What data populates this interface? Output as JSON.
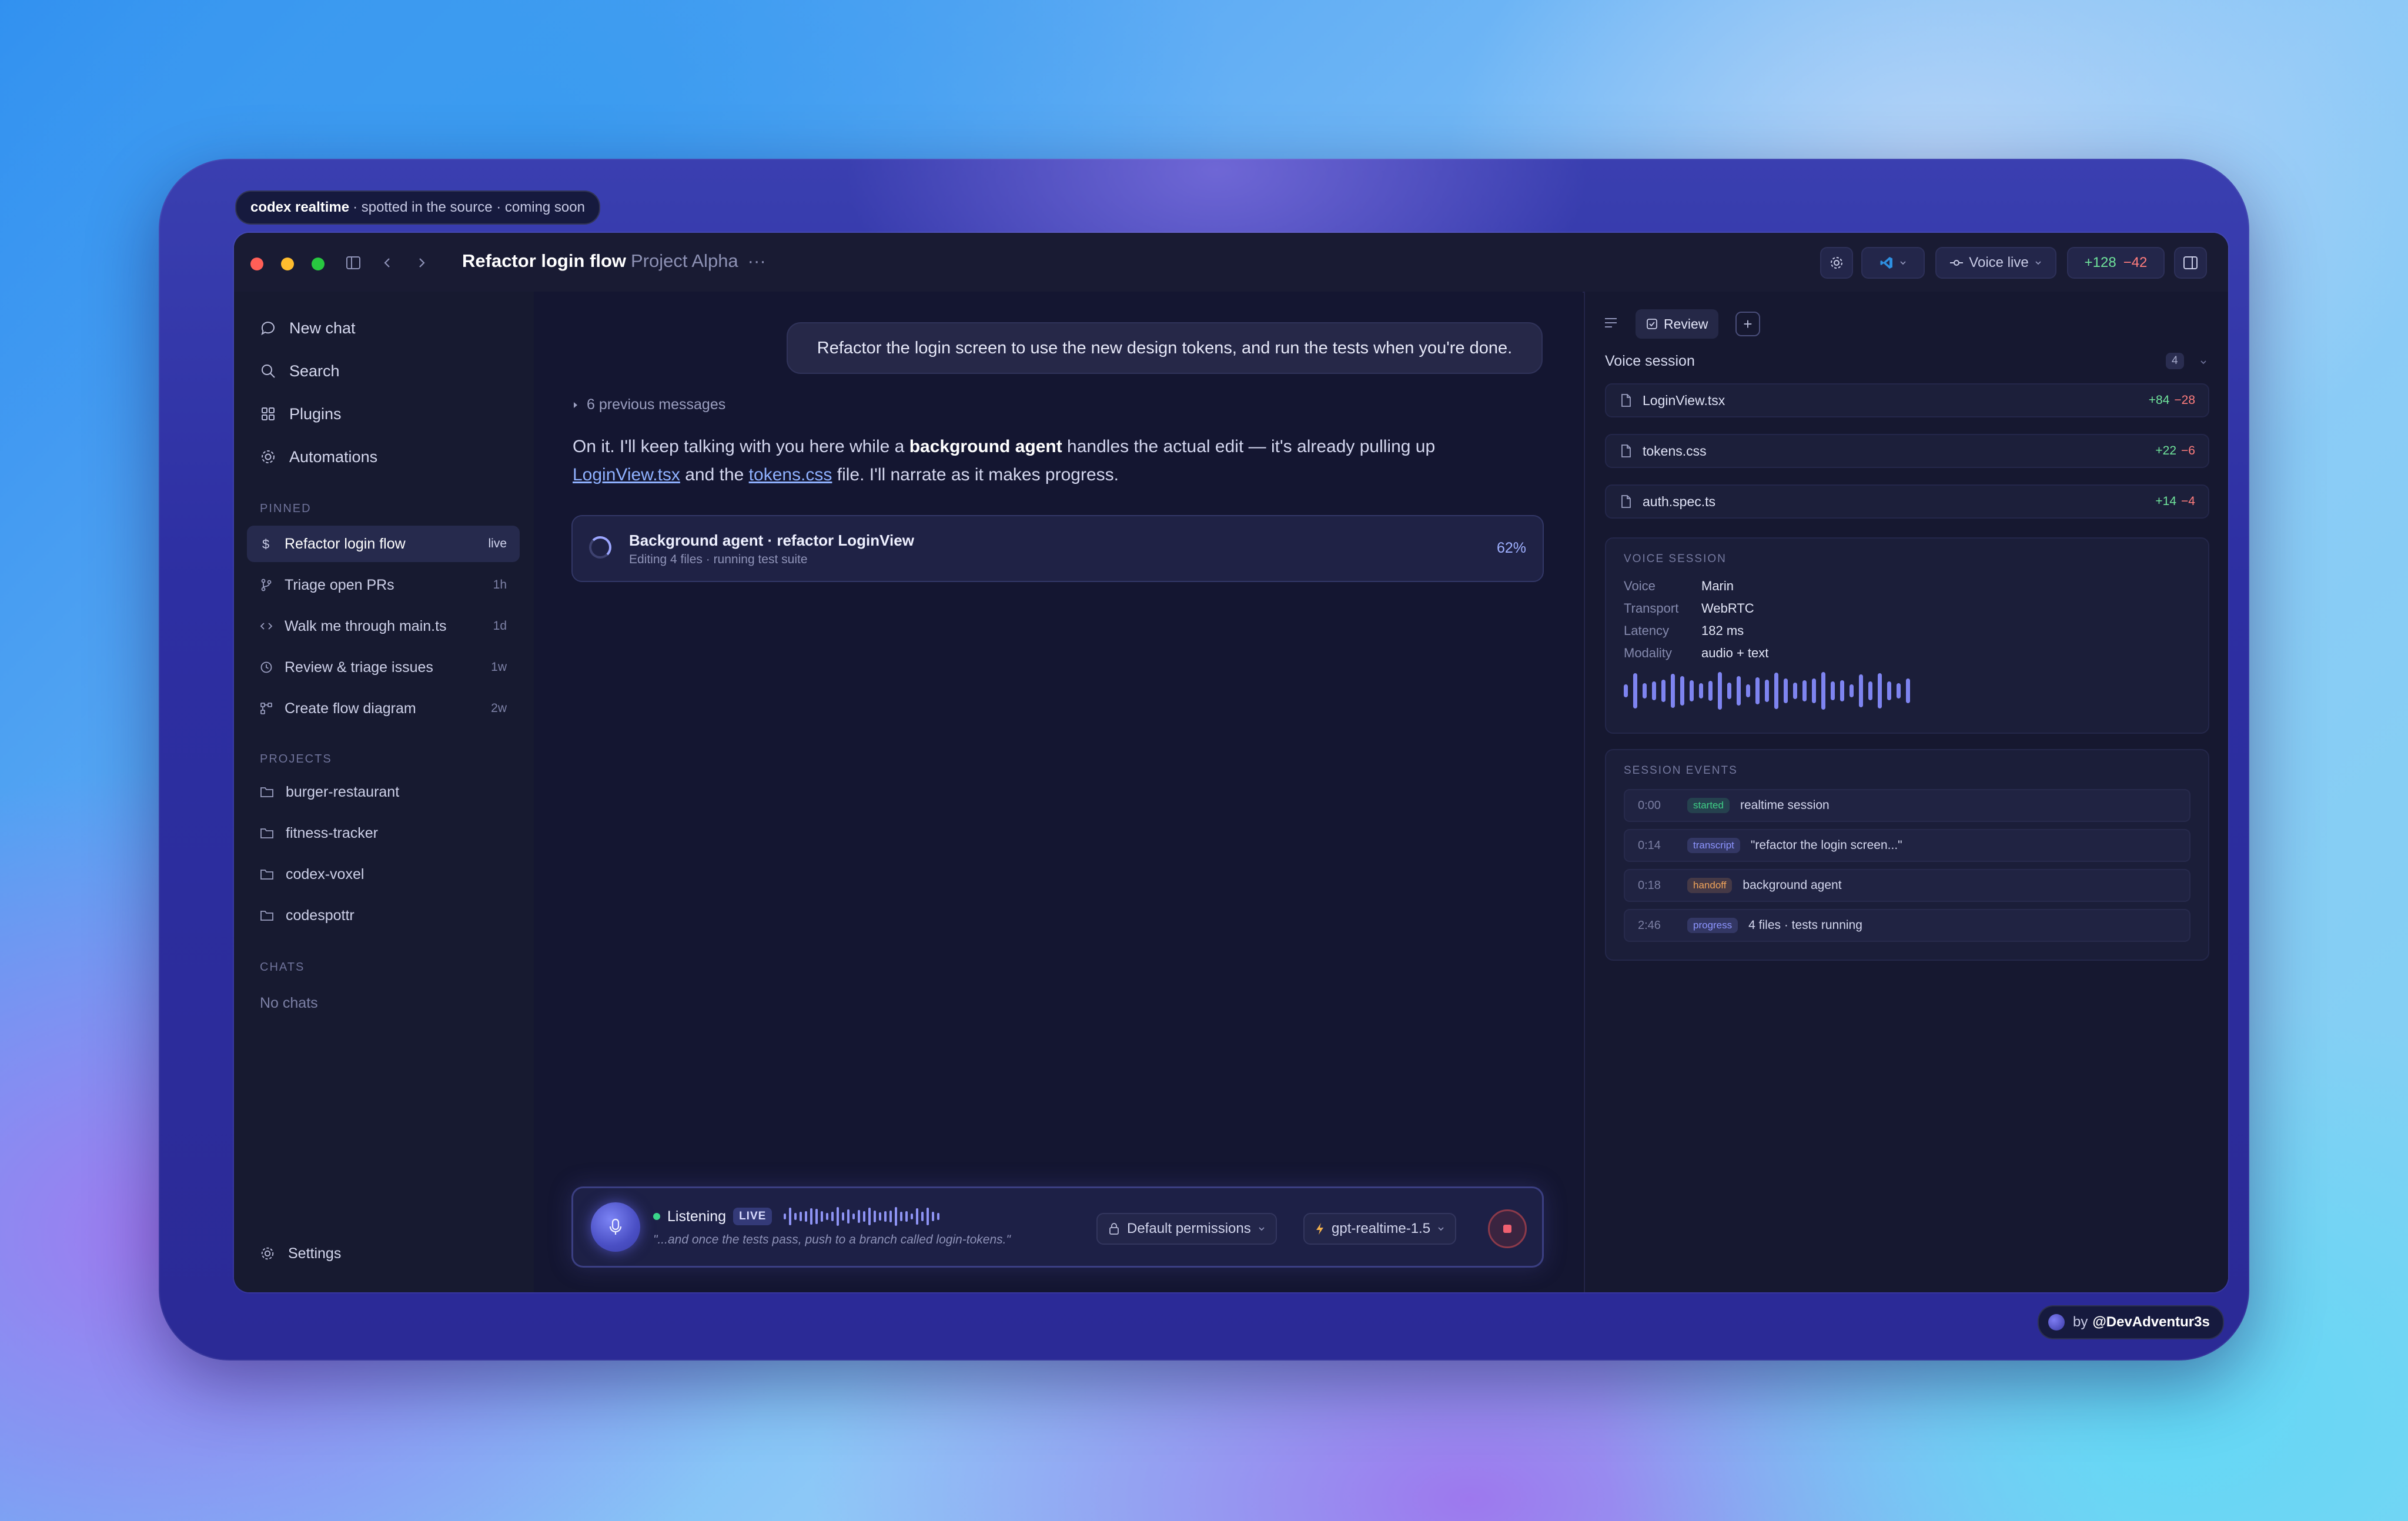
{
  "banner": {
    "brand": "codex realtime",
    "text": "· spotted in the source · coming soon"
  },
  "credit": {
    "prefix": "by",
    "handle": "@DevAdventur3s"
  },
  "titlebar": {
    "title": "Refactor login flow",
    "project": "Project Alpha",
    "more": "···",
    "voice_label": "Voice live",
    "diff_add": "+128",
    "diff_del": "−42"
  },
  "sidebar": {
    "nav": [
      {
        "label": "New chat",
        "icon": "chat-bubble-icon"
      },
      {
        "label": "Search",
        "icon": "search-icon"
      },
      {
        "label": "Plugins",
        "icon": "grid-icon"
      },
      {
        "label": "Automations",
        "icon": "gear-icon"
      }
    ],
    "pinned_label": "PINNED",
    "pinned": [
      {
        "label": "Refactor login flow",
        "age": "live",
        "icon": "dollar-icon"
      },
      {
        "label": "Triage open PRs",
        "age": "1h",
        "icon": "branch-icon"
      },
      {
        "label": "Walk me through main.ts",
        "age": "1d",
        "icon": "code-icon"
      },
      {
        "label": "Review & triage issues",
        "age": "1w",
        "icon": "clock-icon"
      },
      {
        "label": "Create flow diagram",
        "age": "2w",
        "icon": "flow-icon"
      }
    ],
    "projects_label": "PROJECTS",
    "projects": [
      "burger-restaurant",
      "fitness-tracker",
      "codex-voxel",
      "codespottr"
    ],
    "chats_label": "CHATS",
    "no_chats": "No chats",
    "settings": "Settings"
  },
  "chat": {
    "user_message": "Refactor the login screen to use the new design tokens, and run the tests when you're done.",
    "previous": "6 previous messages",
    "reply_1": "On it. I'll keep talking with you here while a ",
    "reply_bold": "background agent",
    "reply_2": " handles the actual edit — it's already pulling up ",
    "link_1": "LoginView.tsx",
    "reply_3": " and the ",
    "link_2": "tokens.css",
    "reply_4": " file. I'll narrate as it makes progress.",
    "agent_title": "Background agent · refactor LoginView",
    "agent_sub": "Editing 4 files · running test suite",
    "agent_progress": "62%"
  },
  "voicebar": {
    "status": "Listening",
    "live": "LIVE",
    "transcript": "\"...and once the tests pass, push to a branch called login-tokens.\"",
    "permissions": "Default permissions",
    "model": "gpt-realtime-1.5"
  },
  "review": {
    "tab": "Review",
    "session_title": "Voice session",
    "session_count": "4",
    "files": [
      {
        "name": "LoginView.tsx",
        "add": "+84",
        "del": "−28"
      },
      {
        "name": "tokens.css",
        "add": "+22",
        "del": "−6"
      },
      {
        "name": "auth.spec.ts",
        "add": "+14",
        "del": "−4"
      }
    ],
    "details_label": "VOICE SESSION",
    "details": [
      {
        "key": "Voice",
        "value": "Marin"
      },
      {
        "key": "Transport",
        "value": "WebRTC"
      },
      {
        "key": "Latency",
        "value": "182 ms"
      },
      {
        "key": "Modality",
        "value": "audio + text"
      }
    ],
    "events_label": "SESSION EVENTS",
    "events": [
      {
        "time": "0:00",
        "tag": "started",
        "text": "realtime session",
        "tag_color": "#3fcf86"
      },
      {
        "time": "0:14",
        "tag": "transcript",
        "text": "\"refactor the login screen...\"",
        "tag_color": "#8d95ff"
      },
      {
        "time": "0:18",
        "tag": "handoff",
        "text": "background agent",
        "tag_color": "#f0a35a"
      },
      {
        "time": "2:46",
        "tag": "progress",
        "text": "4 files · tests running",
        "tag_color": "#8d95ff"
      }
    ]
  },
  "colors": {
    "accent": "#7e84f0",
    "add": "#6fe39b",
    "del": "#ff7d7d"
  }
}
